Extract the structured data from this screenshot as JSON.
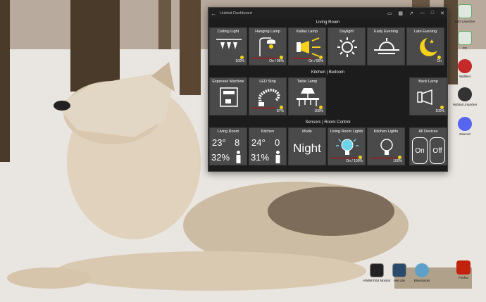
{
  "window": {
    "title": "Hubitat Dashboard",
    "back_icon": "arrow-left-icon",
    "controls": [
      "cast-icon",
      "camera-icon",
      "maximize-icon",
      "minimize-icon",
      "restore-icon",
      "close-icon"
    ]
  },
  "sections": {
    "living_room": "Living Room",
    "kitchen_bedroom": "Kitchen  |  Bedoom",
    "sensors": "Sensors | Room Control"
  },
  "tiles": {
    "ceiling_light": {
      "label": "Ceiling Light",
      "status": "100%",
      "icon": "ceiling-light-icon"
    },
    "hanging_lamp": {
      "label": "Hanging Lamp",
      "status": "On / 95%",
      "icon": "hanging-lamp-icon"
    },
    "kallax_lamp": {
      "label": "Kallax Lamp",
      "status": "On / 80%",
      "icon": "spotlight-icon"
    },
    "daylight": {
      "label": "Daylight",
      "icon": "sun-icon"
    },
    "early_evening": {
      "label": "Early Evening",
      "icon": "sunset-icon"
    },
    "late_evening": {
      "label": "Late Evening",
      "status": "On",
      "icon": "moon-icon"
    },
    "espresso": {
      "label": "Espresso Machine",
      "icon": "espresso-machine-icon"
    },
    "led_strip": {
      "label": "LED Strip",
      "status": "87%",
      "icon": "led-strip-icon"
    },
    "table_lamp": {
      "label": "Table Lamp",
      "status": "100%",
      "icon": "table-lamp-icon"
    },
    "back_lamp": {
      "label": "Back Lamp",
      "status": "100%",
      "icon": "spotlight-icon"
    },
    "living_sensor": {
      "label": "Living Room",
      "temp": "23°",
      "occupancy": "8",
      "humidity": "32%"
    },
    "kitchen_sensor": {
      "label": "Kitchen",
      "temp": "24°",
      "occupancy": "0",
      "humidity": "31%"
    },
    "mode": {
      "label": "Mode",
      "value": "Night"
    },
    "living_lights": {
      "label": "Living Room Lights",
      "status": "On / 100%",
      "icon": "bulb-icon"
    },
    "kitchen_lights": {
      "label": "Kitchen Lights",
      "status": "100%",
      "icon": "bulb-icon"
    },
    "all_devices": {
      "label": "All Devices",
      "on": "On",
      "off": "Off"
    }
  },
  "desktop": {
    "icons": [
      {
        "name": "lsd-launcher-icon",
        "label": "LSD Launcher"
      },
      {
        "name": "pc-icon",
        "label": "PC"
      },
      {
        "name": "wallpaper-icon",
        "label": "Walltest"
      },
      {
        "name": "hubitat-unpacker-icon",
        "label": "Hubitat Unpacker"
      },
      {
        "name": "discord-icon",
        "label": "Discord"
      },
      {
        "name": "hwinfo-icon",
        "label": "HWiNFO64 Monitor"
      },
      {
        "name": "hm-lite-icon",
        "label": "HM Lite"
      },
      {
        "name": "bluestacks-icon",
        "label": "BlueStacks"
      },
      {
        "name": "fire-app-icon",
        "label": "Firefox"
      }
    ]
  }
}
